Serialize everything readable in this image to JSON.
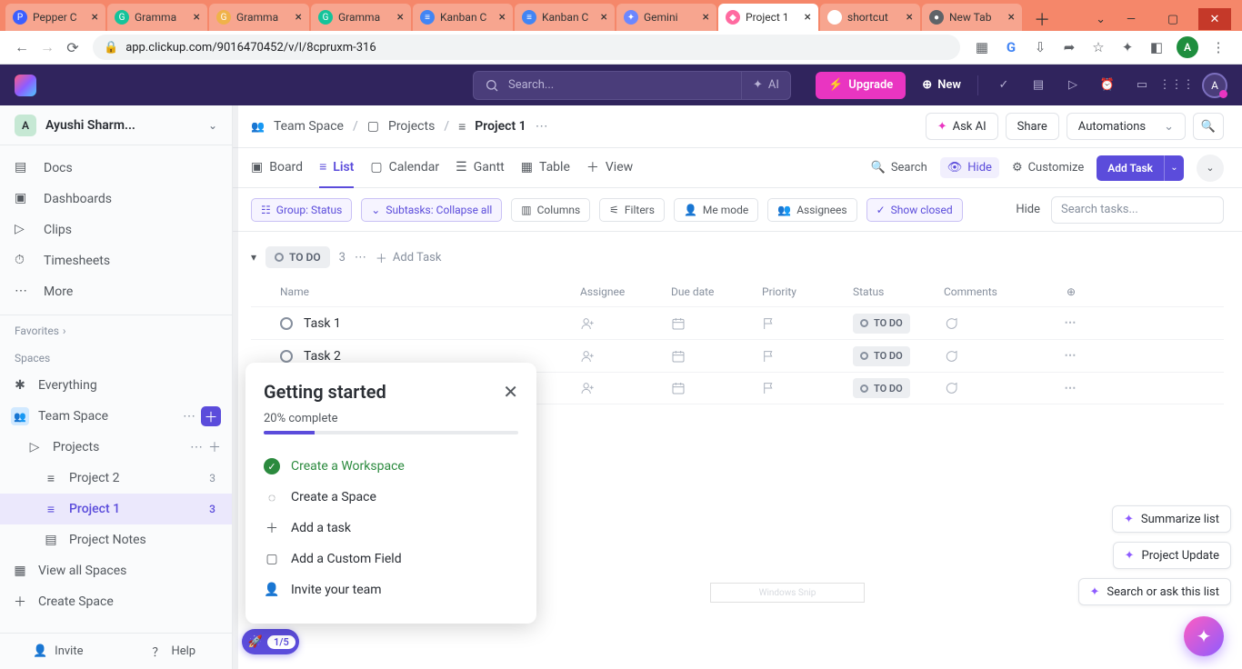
{
  "browser": {
    "tabs": [
      {
        "title": "Pepper C",
        "favicon": "P",
        "favcolor": "#3b5fff"
      },
      {
        "title": "Gramma",
        "favicon": "G",
        "favcolor": "#15c39a"
      },
      {
        "title": "Gramma",
        "favicon": "G",
        "favcolor": "#f0b24a"
      },
      {
        "title": "Gramma",
        "favicon": "G",
        "favcolor": "#15c39a"
      },
      {
        "title": "Kanban C",
        "favicon": "≡",
        "favcolor": "#4285f4"
      },
      {
        "title": "Kanban C",
        "favicon": "≡",
        "favcolor": "#4285f4"
      },
      {
        "title": "Gemini",
        "favicon": "✦",
        "favcolor": "#6c87ff"
      },
      {
        "title": "Project 1",
        "favicon": "◆",
        "favcolor": "#ff6aa0",
        "active": true
      },
      {
        "title": "shortcut",
        "favicon": "G",
        "favcolor": "#ffffff"
      },
      {
        "title": "New Tab",
        "favicon": "●",
        "favcolor": "#5f6368"
      }
    ],
    "url": "app.clickup.com/9016470452/v/l/8cpruxm-316",
    "avatar": "A"
  },
  "topbar": {
    "search_placeholder": "Search...",
    "ai_label": "AI",
    "upgrade": "Upgrade",
    "new": "New",
    "avatar": "A"
  },
  "sidebar": {
    "workspace_initial": "A",
    "workspace_name": "Ayushi Sharm...",
    "nav": [
      {
        "label": "Docs"
      },
      {
        "label": "Dashboards"
      },
      {
        "label": "Clips"
      },
      {
        "label": "Timesheets"
      },
      {
        "label": "More"
      }
    ],
    "favorites_label": "Favorites",
    "spaces_label": "Spaces",
    "everything": "Everything",
    "team_space": "Team Space",
    "projects": "Projects",
    "project2": {
      "label": "Project 2",
      "count": "3"
    },
    "project1": {
      "label": "Project 1",
      "count": "3"
    },
    "project_notes": "Project Notes",
    "view_all": "View all Spaces",
    "create_space": "Create Space",
    "invite": "Invite",
    "help": "Help"
  },
  "breadcrumb": {
    "team": "Team Space",
    "projects": "Projects",
    "current": "Project 1",
    "ask_ai": "Ask AI",
    "share": "Share",
    "automations": "Automations"
  },
  "views": {
    "board": "Board",
    "list": "List",
    "calendar": "Calendar",
    "gantt": "Gantt",
    "table": "Table",
    "view": "View",
    "search": "Search",
    "hide": "Hide",
    "customize": "Customize",
    "add_task": "Add Task"
  },
  "filters": {
    "group": "Group: Status",
    "subtasks": "Subtasks: Collapse all",
    "columns": "Columns",
    "filters": "Filters",
    "me": "Me mode",
    "assignees": "Assignees",
    "closed": "Show closed",
    "hide": "Hide",
    "search_placeholder": "Search tasks..."
  },
  "group": {
    "status": "TO DO",
    "count": "3",
    "add_task": "Add Task"
  },
  "columns": {
    "name": "Name",
    "assignee": "Assignee",
    "due": "Due date",
    "priority": "Priority",
    "status": "Status",
    "comments": "Comments"
  },
  "tasks": [
    {
      "name": "Task 1",
      "status": "TO DO"
    },
    {
      "name": "Task 2",
      "status": "TO DO"
    },
    {
      "name": "",
      "status": "TO DO"
    }
  ],
  "onboarding": {
    "title": "Getting started",
    "pct": "20% complete",
    "items": [
      {
        "label": "Create a Workspace",
        "done": true
      },
      {
        "label": "Create a Space"
      },
      {
        "label": "Add a task"
      },
      {
        "label": "Add a Custom Field"
      },
      {
        "label": "Invite your team"
      }
    ]
  },
  "step_pill": "1/5",
  "float": [
    "Summarize list",
    "Project Update",
    "Search or ask this list"
  ],
  "watermark": "Windows Snip"
}
